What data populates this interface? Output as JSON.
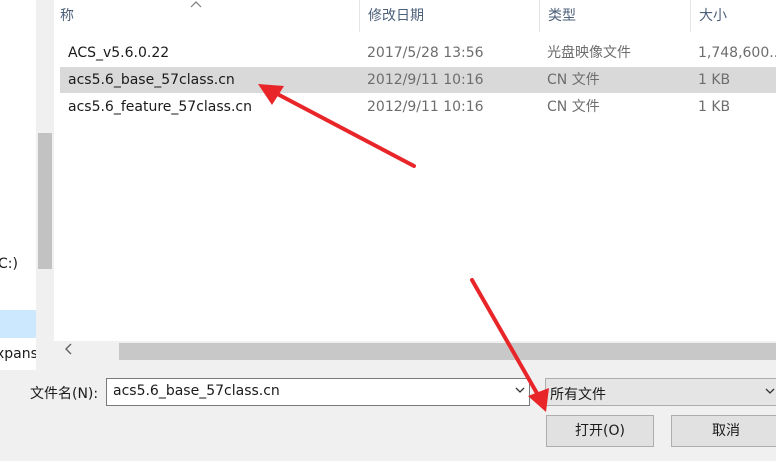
{
  "nav": {
    "items": [
      {
        "label": "C:)"
      },
      {
        "label": ""
      },
      {
        "label": "xpans"
      }
    ]
  },
  "columns": {
    "name": "称",
    "date": "修改日期",
    "type": "类型",
    "size": "大小"
  },
  "files": [
    {
      "name": "ACS_v5.6.0.22",
      "date": "2017/5/28 13:56",
      "type": "光盘映像文件",
      "size": "1,748,600..."
    },
    {
      "name": "acs5.6_base_57class.cn",
      "date": "2012/9/11 10:16",
      "type": "CN 文件",
      "size": "1 KB",
      "selected": true
    },
    {
      "name": "acs5.6_feature_57class.cn",
      "date": "2012/9/11 10:16",
      "type": "CN 文件",
      "size": "1 KB"
    }
  ],
  "filename": {
    "label": "文件名(N):",
    "value": "acs5.6_base_57class.cn"
  },
  "filetype": {
    "value": "所有文件"
  },
  "buttons": {
    "open": "打开(O)",
    "cancel": "取消"
  },
  "icons": {
    "sort": "chevron-up-icon",
    "scroll_left": "chevron-left-icon",
    "dropdown": "chevron-down-icon"
  },
  "colors": {
    "selection": "#d9d9d9",
    "annotation_arrow": "#e8262a"
  }
}
